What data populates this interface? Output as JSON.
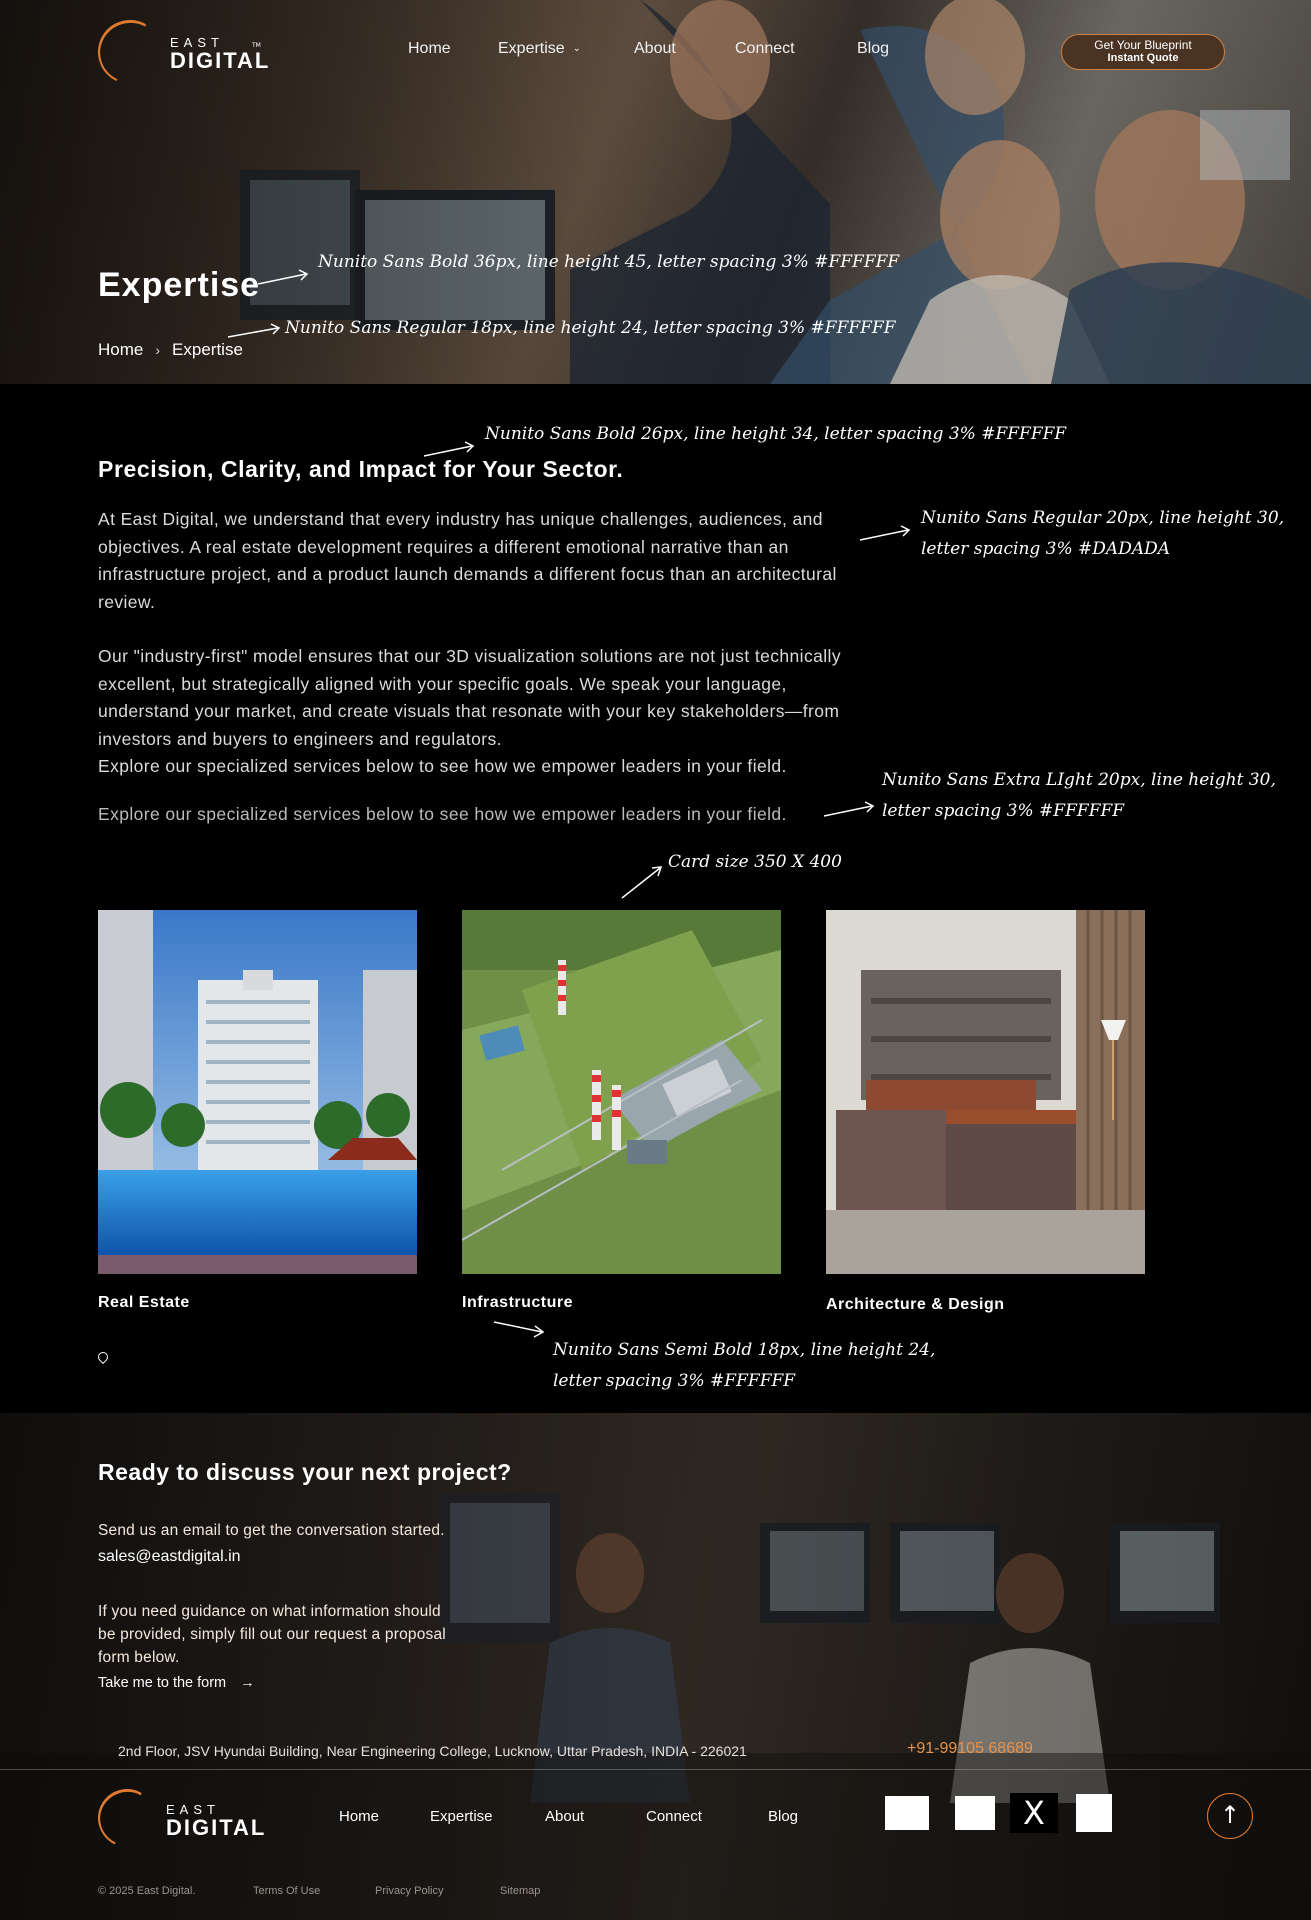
{
  "header": {
    "logo": {
      "east": "EAST",
      "digital": "DIGITAL",
      "tm": "TM"
    },
    "nav": [
      "Home",
      "Expertise",
      "About",
      "Connect",
      "Blog"
    ],
    "cta": {
      "line1": "Get Your Blueprint",
      "line2": "Instant Quote"
    }
  },
  "hero": {
    "title": "Expertise",
    "breadcrumb": [
      "Home",
      "Expertise"
    ]
  },
  "annotations": {
    "a1": "Nunito Sans Bold 36px, line height 45, letter spacing 3% #FFFFFF",
    "a2": "Nunito Sans Regular 18px, line height 24, letter spacing 3% #FFFFFF",
    "a3": "Nunito Sans Bold 26px, line height 34, letter spacing 3% #FFFFFF",
    "a4_l1": "Nunito Sans Regular 20px, line height 30,",
    "a4_l2": "letter spacing 3% #DADADA",
    "a5_l1": "Nunito Sans Extra LIght 20px, line height 30,",
    "a5_l2": "letter spacing 3% #FFFFFF",
    "a6": "Card size 350 X 400",
    "a7_l1": "Nunito Sans Semi Bold 18px, line height 24,",
    "a7_l2": "letter spacing 3% #FFFFFF"
  },
  "main": {
    "heading": "Precision, Clarity, and Impact for Your Sector.",
    "para1": "At East Digital, we understand that every industry has unique challenges, audiences, and objectives. A real estate development requires a different emotional narrative than an infrastructure project, and a product launch demands a different focus than an architectural review.",
    "para2": "Our \"industry-first\" model ensures that our 3D visualization solutions are not just technically excellent, but strategically aligned with your specific goals. We speak your language, understand your market, and create visuals that resonate with your key stakeholders—from investors and buyers to engineers and regulators.",
    "para3": "Explore our specialized services below to see how we empower leaders in your field.",
    "para_light": "Explore our specialized services below to see how we empower leaders in your field.",
    "cards": [
      {
        "label": "Real Estate"
      },
      {
        "label": "Infrastructure"
      },
      {
        "label": "Architecture & Design"
      }
    ]
  },
  "contact": {
    "title": "Ready to discuss your next project?",
    "intro": "Send us an email to get the conversation started.",
    "email": "sales@eastdigital.in",
    "guidance_l1": "If you need guidance on what information should",
    "guidance_l2": "be provided, simply fill out our request a proposal",
    "guidance_l3": "form below.",
    "link": "Take me to the form",
    "link_arrow": "→",
    "address": "2nd Floor, JSV Hyundai Building, Near Engineering College, Lucknow, Uttar Pradesh, INDIA - 226021",
    "phone": "+91-99105 68689"
  },
  "footer": {
    "nav": [
      "Home",
      "Expertise",
      "About",
      "Connect",
      "Blog"
    ],
    "social_x": "X",
    "to_top": "↑",
    "copyright": "© 2025 East Digital.",
    "legal": [
      "Terms Of Use",
      "Privacy Policy",
      "Sitemap"
    ]
  },
  "colors": {
    "accent": "#E07A2E",
    "body_text": "#DADADA",
    "phone": "#E9924A"
  }
}
